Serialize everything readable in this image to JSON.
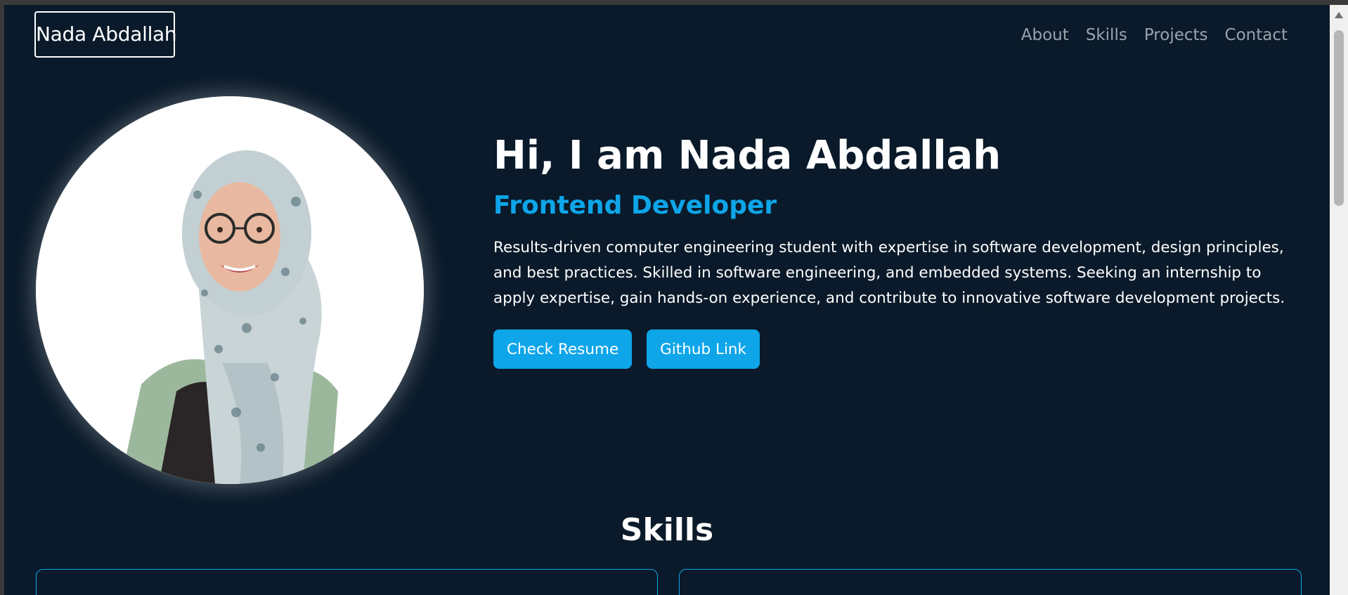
{
  "navbar": {
    "brand": "Nada Abdallah",
    "links": [
      "About",
      "Skills",
      "Projects",
      "Contact"
    ]
  },
  "hero": {
    "greeting": "Hi, I am Nada Abdallah",
    "role": "Frontend Developer",
    "description": "Results-driven computer engineering student with expertise in software development, design principles, and best practices. Skilled in software engineering, and embedded systems. Seeking an internship to apply expertise, gain hands-on experience, and contribute to innovative software development projects.",
    "buttons": {
      "resume": "Check Resume",
      "github": "Github Link"
    }
  },
  "skills": {
    "heading": "Skills"
  },
  "colors": {
    "background": "#0a1a2a",
    "accent": "#0ea5e9",
    "text": "#ffffff",
    "nav_link": "#9aa3ad"
  }
}
